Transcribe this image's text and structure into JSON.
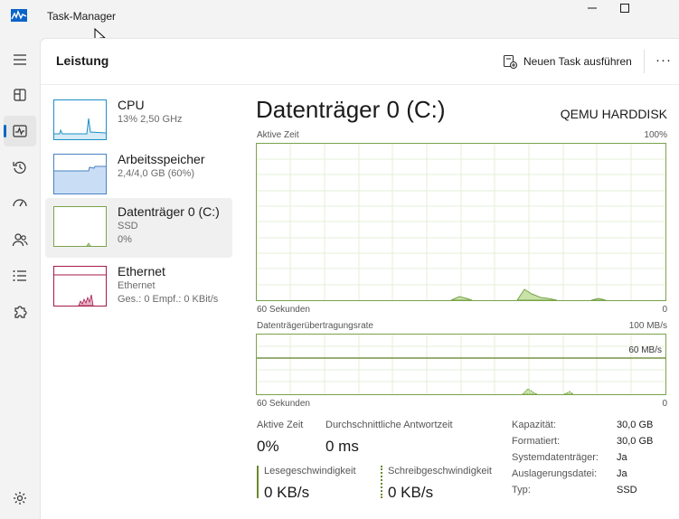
{
  "window": {
    "title": "Task-Manager"
  },
  "header": {
    "title": "Leistung",
    "run_task_label": "Neuen Task ausführen",
    "more_label": "···"
  },
  "colors": {
    "accent": "#0067c0",
    "disk_graph": "#7aa34a",
    "disk_fill": "#c8e2a8",
    "cpu_graph": "#1e8fc6",
    "mem_graph": "#4a82c3",
    "mem_fill": "#c9def5",
    "eth_graph": "#a41a4a",
    "eth_fill": "#e9b3c7"
  },
  "rail_icons": [
    "menu-icon",
    "processes-icon",
    "performance-icon",
    "app-history-icon",
    "startup-apps-icon",
    "users-icon",
    "details-icon",
    "services-icon",
    "settings-icon"
  ],
  "resources": [
    {
      "name": "CPU",
      "lines": [
        "13% 2,50 GHz"
      ]
    },
    {
      "name": "Arbeitsspeicher",
      "lines": [
        "2,4/4,0 GB (60%)"
      ]
    },
    {
      "name": "Datenträger 0 (C:)",
      "lines": [
        "SSD",
        "0%"
      ]
    },
    {
      "name": "Ethernet",
      "lines": [
        "Ethernet",
        "Ges.: 0 Empf.: 0 KBit/s"
      ]
    }
  ],
  "detail": {
    "title": "Datenträger 0 (C:)",
    "model": "QEMU HARDDISK",
    "active_graph": {
      "label": "Aktive Zeit",
      "max": "100%",
      "time_label": "60 Sekunden",
      "min": "0"
    },
    "transfer_graph": {
      "label": "Datenträgerübertragungsrate",
      "max": "100 MB/s",
      "ref_line": "60 MB/s",
      "time_label": "60 Sekunden",
      "min": "0"
    },
    "stats": {
      "active_time_label": "Aktive Zeit",
      "active_time_value": "0%",
      "response_label": "Durchschnittliche Antwortzeit",
      "response_value": "0 ms",
      "read_label": "Lesegeschwindigkeit",
      "read_value": "0 KB/s",
      "write_label": "Schreibgeschwindigkeit",
      "write_value": "0 KB/s"
    },
    "properties": [
      {
        "label": "Kapazität:",
        "value": "30,0 GB"
      },
      {
        "label": "Formatiert:",
        "value": "30,0 GB"
      },
      {
        "label": "Systemdatenträger:",
        "value": "Ja"
      },
      {
        "label": "Auslagerungsdatei:",
        "value": "Ja"
      },
      {
        "label": "Typ:",
        "value": "SSD"
      }
    ]
  }
}
